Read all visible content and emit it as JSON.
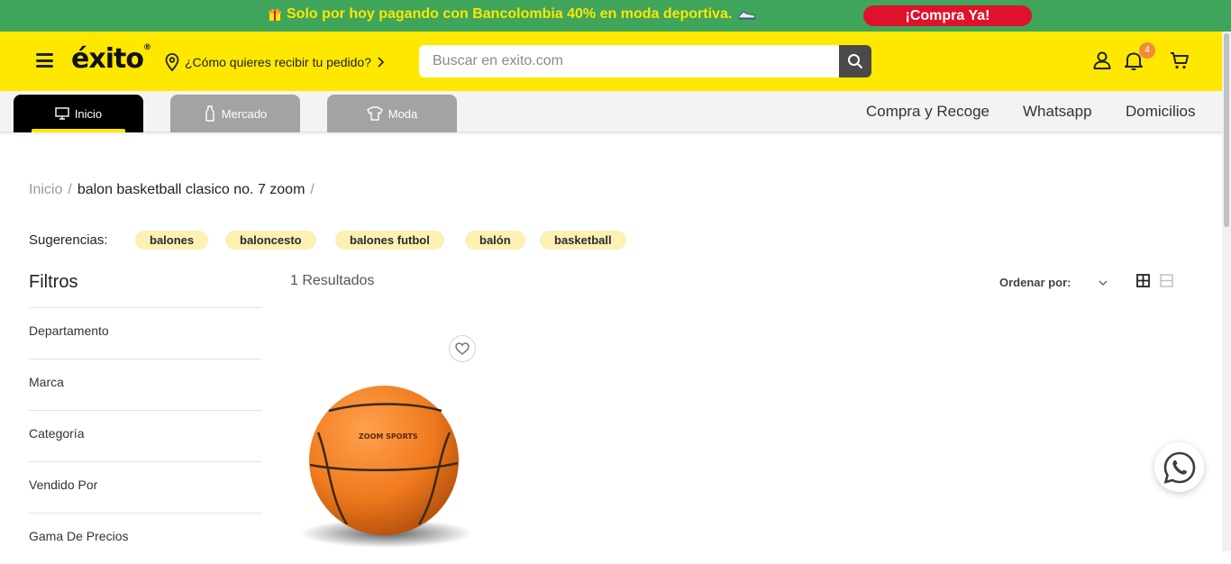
{
  "promo": {
    "text": "Solo por hoy pagando con Bancolombia 40% en moda deportiva.",
    "cta": "¡Compra Ya!"
  },
  "header": {
    "logo": "éxito",
    "delivery_prompt": "¿Cómo quieres recibir tu pedido?",
    "search_placeholder": "Buscar en exito.com",
    "notifications_count": "4"
  },
  "nav": {
    "tabs": [
      {
        "label": "Inicio",
        "icon": "monitor-icon",
        "active": true
      },
      {
        "label": "Mercado",
        "icon": "bottle-icon",
        "active": false
      },
      {
        "label": "Moda",
        "icon": "shirt-icon",
        "active": false
      }
    ],
    "links": [
      "Compra y Recoge",
      "Whatsapp",
      "Domicilios"
    ]
  },
  "breadcrumb": {
    "home": "Inicio",
    "current": "balon basketball clasico no. 7 zoom"
  },
  "suggestions": {
    "label": "Sugerencias:",
    "chips": [
      "balones",
      "baloncesto",
      "balones futbol",
      "balón",
      "basketball"
    ]
  },
  "filters": {
    "title": "Filtros",
    "items": [
      "Departamento",
      "Marca",
      "Categoría",
      "Vendido Por",
      "Gama De Precios"
    ]
  },
  "results": {
    "count_text": "1 Resultados",
    "sort_label": "Ordenar por:"
  },
  "product": {
    "brand_print": "ZOOM SPORTS"
  },
  "colors": {
    "promo_bg": "#3fa55b",
    "brand_yellow": "#ffe800",
    "cta_red": "#e0112b"
  }
}
